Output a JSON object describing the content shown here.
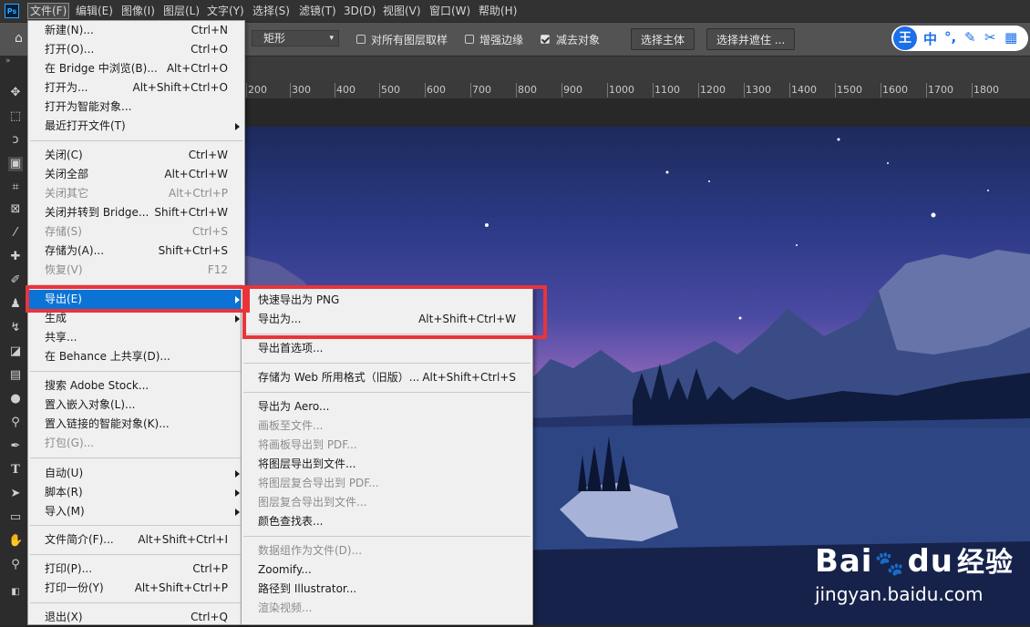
{
  "app": {
    "logo": "Ps"
  },
  "menubar": [
    "文件(F)",
    "编辑(E)",
    "图像(I)",
    "图层(L)",
    "文字(Y)",
    "选择(S)",
    "滤镜(T)",
    "3D(D)",
    "视图(V)",
    "窗口(W)",
    "帮助(H)"
  ],
  "options": {
    "shape_value": "矩形",
    "sample_all_layers": "对所有图层取样",
    "harden_edges": "增强边缘",
    "subtract_object": "减去对象",
    "select_subject": "选择主体",
    "select_and_mask": "选择并遮住 ..."
  },
  "ime": {
    "wang": "王",
    "zhong": "中"
  },
  "ruler_ticks": [
    "200",
    "300",
    "400",
    "500",
    "600",
    "700",
    "800",
    "900",
    "1000",
    "1100",
    "1200",
    "1300",
    "1400",
    "1500",
    "1600",
    "1700",
    "1800"
  ],
  "file_menu": [
    {
      "label": "新建(N)...",
      "shortcut": "Ctrl+N"
    },
    {
      "label": "打开(O)...",
      "shortcut": "Ctrl+O"
    },
    {
      "label": "在 Bridge 中浏览(B)...",
      "shortcut": "Alt+Ctrl+O"
    },
    {
      "label": "打开为...",
      "shortcut": "Alt+Shift+Ctrl+O"
    },
    {
      "label": "打开为智能对象...",
      "shortcut": ""
    },
    {
      "label": "最近打开文件(T)",
      "shortcut": ""
    },
    {
      "label": "关闭(C)",
      "shortcut": "Ctrl+W"
    },
    {
      "label": "关闭全部",
      "shortcut": "Alt+Ctrl+W"
    },
    {
      "label": "关闭其它",
      "shortcut": "Alt+Ctrl+P"
    },
    {
      "label": "关闭并转到 Bridge...",
      "shortcut": "Shift+Ctrl+W"
    },
    {
      "label": "存储(S)",
      "shortcut": "Ctrl+S"
    },
    {
      "label": "存储为(A)...",
      "shortcut": "Shift+Ctrl+S"
    },
    {
      "label": "恢复(V)",
      "shortcut": "F12"
    },
    {
      "label": "导出(E)",
      "shortcut": ""
    },
    {
      "label": "生成",
      "shortcut": ""
    },
    {
      "label": "共享...",
      "shortcut": ""
    },
    {
      "label": "在 Behance 上共享(D)...",
      "shortcut": ""
    },
    {
      "label": "搜索 Adobe Stock...",
      "shortcut": ""
    },
    {
      "label": "置入嵌入对象(L)...",
      "shortcut": ""
    },
    {
      "label": "置入链接的智能对象(K)...",
      "shortcut": ""
    },
    {
      "label": "打包(G)...",
      "shortcut": ""
    },
    {
      "label": "自动(U)",
      "shortcut": ""
    },
    {
      "label": "脚本(R)",
      "shortcut": ""
    },
    {
      "label": "导入(M)",
      "shortcut": ""
    },
    {
      "label": "文件简介(F)...",
      "shortcut": "Alt+Shift+Ctrl+I"
    },
    {
      "label": "打印(P)...",
      "shortcut": "Ctrl+P"
    },
    {
      "label": "打印一份(Y)",
      "shortcut": "Alt+Shift+Ctrl+P"
    },
    {
      "label": "退出(X)",
      "shortcut": "Ctrl+Q"
    }
  ],
  "export_menu": [
    {
      "label": "快速导出为 PNG",
      "shortcut": ""
    },
    {
      "label": "导出为...",
      "shortcut": "Alt+Shift+Ctrl+W"
    },
    {
      "label": "导出首选项...",
      "shortcut": ""
    },
    {
      "label": "存储为 Web 所用格式（旧版）...",
      "shortcut": "Alt+Shift+Ctrl+S"
    },
    {
      "label": "导出为 Aero...",
      "shortcut": ""
    },
    {
      "label": "画板至文件...",
      "shortcut": ""
    },
    {
      "label": "将画板导出到 PDF...",
      "shortcut": ""
    },
    {
      "label": "将图层导出到文件...",
      "shortcut": ""
    },
    {
      "label": "将图层复合导出到 PDF...",
      "shortcut": ""
    },
    {
      "label": "图层复合导出到文件...",
      "shortcut": ""
    },
    {
      "label": "颜色查找表...",
      "shortcut": ""
    },
    {
      "label": "数据组作为文件(D)...",
      "shortcut": ""
    },
    {
      "label": "Zoomify...",
      "shortcut": ""
    },
    {
      "label": "路径到 Illustrator...",
      "shortcut": ""
    },
    {
      "label": "渲染视频...",
      "shortcut": ""
    }
  ],
  "watermark": {
    "brand_a": "Bai",
    "brand_b": "du",
    "brand_c": "经验",
    "url": "jingyan.baidu.com"
  },
  "colors": {
    "highlight": "#0c73d6",
    "annotation_box": "#e8343a",
    "menu_bg": "#f0f0f0"
  }
}
